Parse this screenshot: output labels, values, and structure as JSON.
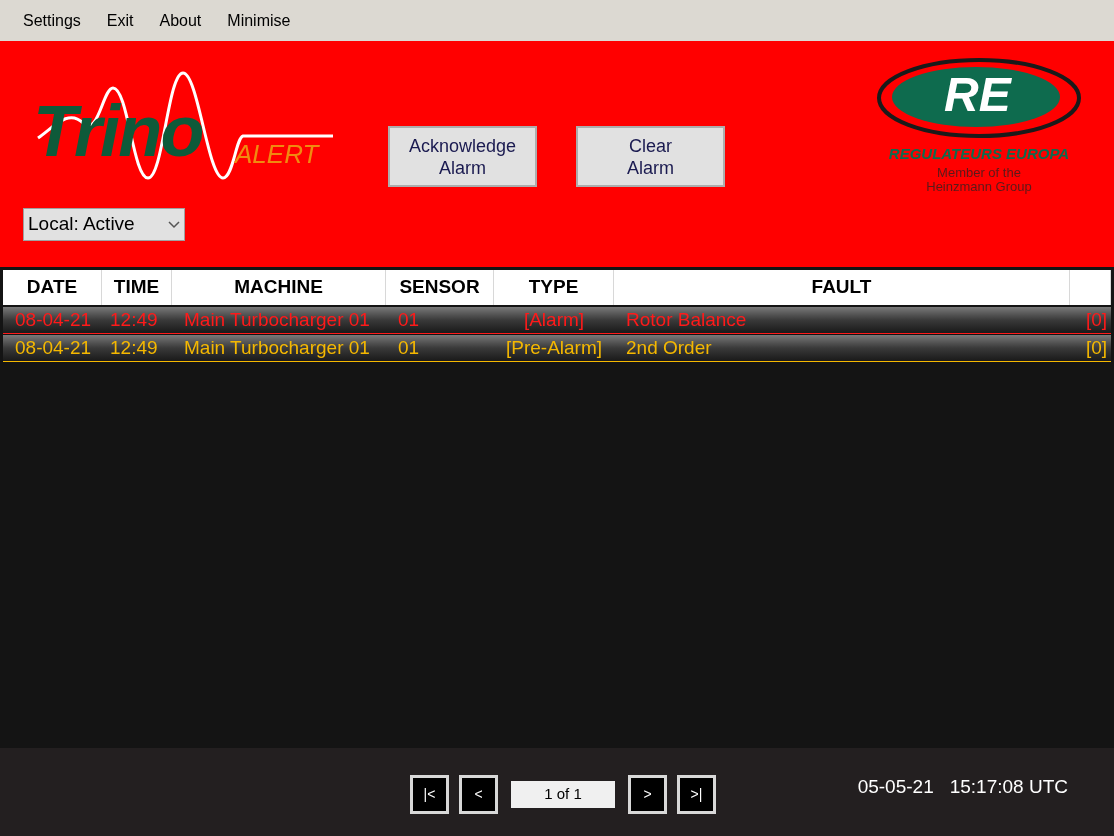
{
  "menu": [
    "Settings",
    "Exit",
    "About",
    "Minimise"
  ],
  "logo": {
    "name": "Trino",
    "suffix": "ALERT"
  },
  "buttons": [
    "Acknowledge\nAlarm",
    "Clear\nAlarm"
  ],
  "mode_select": {
    "value": "Local: Active"
  },
  "brand": {
    "mark": "RE",
    "name": "REGULATEURS EUROPA",
    "tagline": "Member of the\nHeinzmann Group"
  },
  "table": {
    "columns": [
      "DATE",
      "TIME",
      "MACHINE",
      "SENSOR",
      "TYPE",
      "FAULT"
    ],
    "rows": [
      {
        "color": "#ff1a1a",
        "cells": [
          "08-04-21",
          "12:49",
          "Main Turbocharger 01",
          "01",
          "[Alarm]",
          "Rotor Balance",
          "[0]"
        ]
      },
      {
        "color": "#f5b800",
        "cells": [
          "08-04-21",
          "12:49",
          "Main Turbocharger 01",
          "01",
          "[Pre-Alarm]",
          "2nd Order",
          "[0]"
        ]
      }
    ]
  },
  "pager": {
    "first": "|<",
    "prev": "<",
    "page": "1 of 1",
    "next": ">",
    "last": ">|"
  },
  "status": {
    "date": "05-05-21",
    "time": "15:17:08 UTC"
  }
}
